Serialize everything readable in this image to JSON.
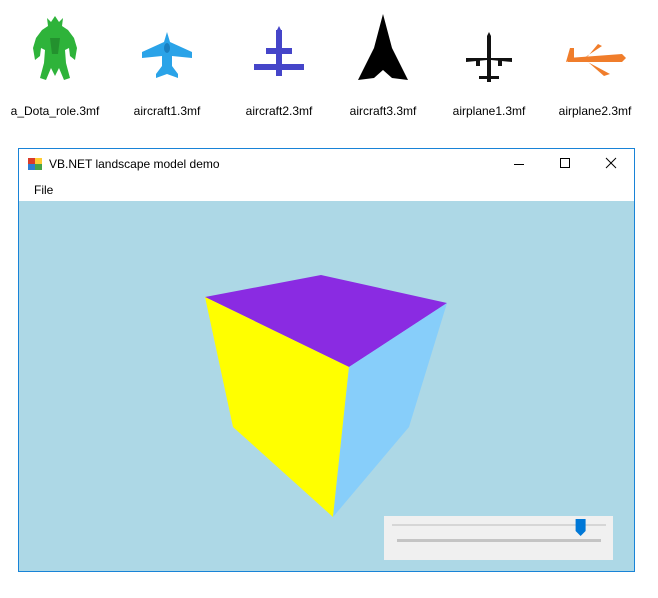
{
  "thumbnails": [
    {
      "label": "a_Dota_role.3mf",
      "icon": "green-creature-icon",
      "color": "#2eb33a"
    },
    {
      "label": "aircraft1.3mf",
      "icon": "blue-jet-icon",
      "color": "#2aa3e8"
    },
    {
      "label": "aircraft2.3mf",
      "icon": "indigo-plane-icon",
      "color": "#4545c9"
    },
    {
      "label": "aircraft3.3mf",
      "icon": "black-stealth-icon",
      "color": "#000000"
    },
    {
      "label": "airplane1.3mf",
      "icon": "black-airliner-icon",
      "color": "#111111"
    },
    {
      "label": "airplane2.3mf",
      "icon": "orange-airliner-icon",
      "color": "#f07d2b"
    }
  ],
  "window": {
    "title": "VB.NET landscape model demo",
    "menu": {
      "file": "File"
    },
    "background_color": "#add8e6",
    "border_color": "#1883d7"
  },
  "cube": {
    "top_color": "#8a2be2",
    "left_color": "#ffff00",
    "right_color": "#87cefa"
  },
  "slider": {
    "value_fraction": 0.9
  }
}
